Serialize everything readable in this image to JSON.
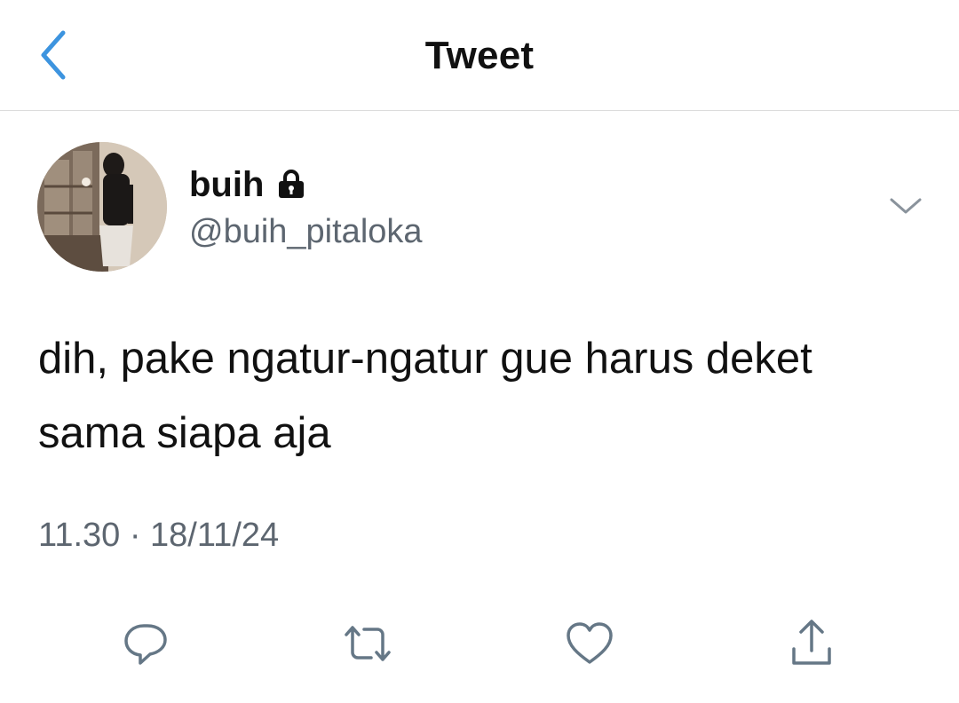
{
  "header": {
    "title": "Tweet",
    "back_icon": "chevron-left-icon",
    "accent_color": "#3d94df"
  },
  "tweet": {
    "author": {
      "display_name": "buih",
      "handle": "@buih_pitaloka",
      "protected_icon": "lock-icon"
    },
    "menu_icon": "chevron-down-icon",
    "text": "dih, pake ngatur-ngatur gue harus deket sama siapa aja",
    "meta": "11.30 · 18/11/24",
    "actions": [
      {
        "name": "reply",
        "icon": "reply-icon"
      },
      {
        "name": "retweet",
        "icon": "retweet-icon"
      },
      {
        "name": "like",
        "icon": "heart-icon"
      },
      {
        "name": "share",
        "icon": "share-icon"
      }
    ]
  }
}
